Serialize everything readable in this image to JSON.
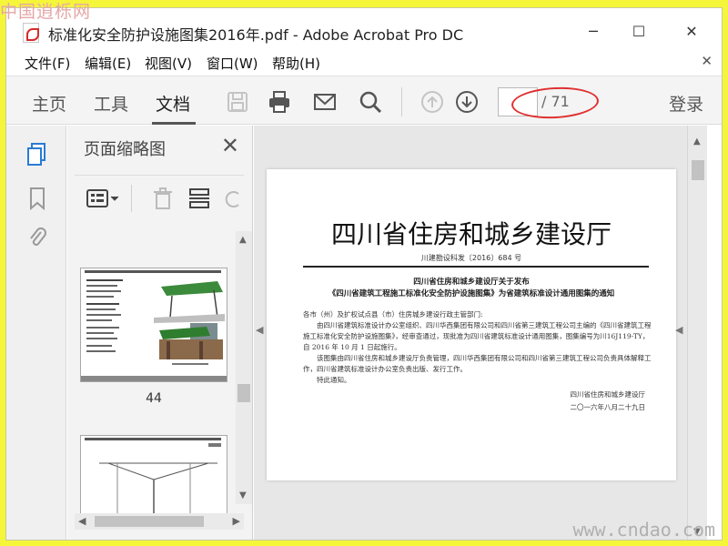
{
  "watermarks": {
    "top_left": "中国逍栎网",
    "bottom_right": "www.cndao.com"
  },
  "window": {
    "title": "标准化安全防护设施图集2016年.pdf - Adobe Acrobat Pro DC"
  },
  "menu": [
    "文件(F)",
    "编辑(E)",
    "视图(V)",
    "窗口(W)",
    "帮助(H)"
  ],
  "toolbar": {
    "tabs": [
      "主页",
      "工具",
      "文档"
    ],
    "active_tab": "文档",
    "page_input": "",
    "page_total": "/ 71",
    "login": "登录"
  },
  "panel": {
    "title": "页面缩略图",
    "thumb_page_label": "44"
  },
  "document": {
    "big_title": "四川省住房和城乡建设厅",
    "doc_number": "川建勘设科发〔2016〕684 号",
    "subtitle_line1": "四川省住房和城乡建设厅关于发布",
    "subtitle_line2": "《四川省建筑工程施工标准化安全防护设施图集》为省建筑标准设计通用图集的通知",
    "salutation": "各市（州）及扩权试点县（市）住房城乡建设行政主管部门:",
    "para1": "由四川省建筑标准设计办公室组织、四川华西集团有限公司和四川省第三建筑工程公司主编的《四川省建筑工程施工标准化安全防护设施图集》，经审查通过，现批准为四川省建筑标准设计通用图集，图集编号为川16J119-TY，自 2016 年 10 月 1 日起施行。",
    "para2": "该图集由四川省住房和城乡建设厅负责管理，四川华西集团有限公司和四川省第三建筑工程公司负责具体解释工作，四川省建筑标准设计办公室负责出版、发行工作。",
    "closing": "特此通知。",
    "sign_org": "四川省住房和城乡建设厅",
    "sign_date": "二〇一六年八月二十九日"
  },
  "colors": {
    "annotation": "#e03030",
    "background": "#f5f53a"
  }
}
